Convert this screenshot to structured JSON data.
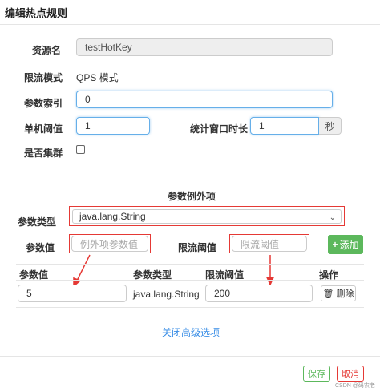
{
  "dialog": {
    "title": "编辑热点规则"
  },
  "form": {
    "resource_label": "资源名",
    "resource_value": "testHotKey",
    "mode_label": "限流模式",
    "mode_value": "QPS 模式",
    "index_label": "参数索引",
    "index_value": "0",
    "threshold_label": "单机阈值",
    "threshold_value": "1",
    "window_label": "统计窗口时长",
    "window_value": "1",
    "window_unit": "秒",
    "cluster_label": "是否集群",
    "cluster_checked": false
  },
  "exceptions": {
    "section_title": "参数例外项",
    "type_label": "参数类型",
    "type_selected": "java.lang.String",
    "value_label": "参数值",
    "value_placeholder": "例外项参数值",
    "limit_label": "限流阈值",
    "limit_placeholder": "限流阈值",
    "add_button": "添加",
    "table": {
      "headers": [
        "参数值",
        "参数类型",
        "限流阈值",
        "操作"
      ],
      "rows": [
        {
          "value": "5",
          "type": "java.lang.String",
          "limit": "200",
          "action": "删除"
        }
      ]
    },
    "close_advanced": "关闭高级选项"
  },
  "footer": {
    "save_label": "保存",
    "cancel_label": "取消",
    "watermark": "CSDN @码农老板"
  },
  "colors": {
    "accent_blue": "#66afe9",
    "link_blue": "#3a8ee6",
    "success_green": "#5cb85c",
    "annotation_red": "#e53935"
  }
}
